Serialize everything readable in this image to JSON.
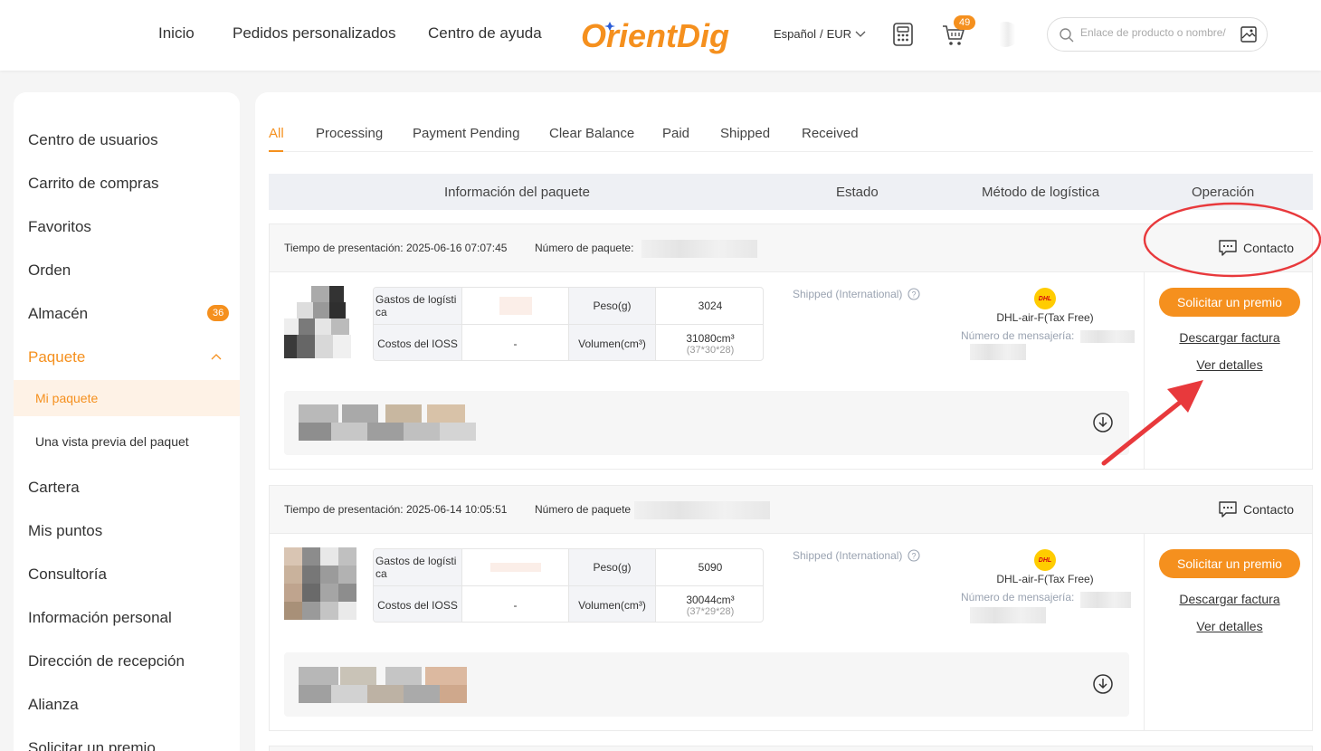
{
  "header": {
    "nav": [
      "Inicio",
      "Pedidos personalizados",
      "Centro de ayuda"
    ],
    "logo_text": "OrientDig",
    "language": "Español",
    "currency": "EUR",
    "cart_count": "49",
    "search_placeholder": "Enlace de producto o nombre/",
    "icons": [
      "calculator-icon",
      "cart-icon",
      "image-search-icon",
      "search-icon",
      "chevron-down-icon"
    ],
    "accent_color": "#f5901e"
  },
  "sidebar": {
    "items": [
      {
        "label": "Centro de usuarios"
      },
      {
        "label": "Carrito de compras"
      },
      {
        "label": "Favoritos"
      },
      {
        "label": "Orden"
      },
      {
        "label": "Almacén",
        "badge": "36"
      },
      {
        "label": "Paquete",
        "expanded": true
      },
      {
        "label": "Mi paquete",
        "sub": true,
        "active": true
      },
      {
        "label": "Una vista previa del paquet",
        "sub": true
      },
      {
        "label": "Cartera"
      },
      {
        "label": "Mis puntos"
      },
      {
        "label": "Consultoría"
      },
      {
        "label": "Información personal"
      },
      {
        "label": "Dirección de recepción"
      },
      {
        "label": "Alianza"
      },
      {
        "label": "Solicitar un premio"
      }
    ]
  },
  "tabs": [
    "All",
    "Processing",
    "Payment Pending",
    "Clear Balance",
    "Paid",
    "Shipped",
    "Received"
  ],
  "active_tab": "All",
  "table_headers": [
    "Información del paquete",
    "Estado",
    "Método de logística",
    "Operación"
  ],
  "labels": {
    "submit_time": "Tiempo de presentación:",
    "package_number": "Número de paquete:",
    "package_number_alt": "Número de paquete",
    "contact": "Contacto",
    "shipping_cost": "Gastos de logísti ca",
    "ioss_cost": "Costos del IOSS",
    "weight": "Peso(g)",
    "volume": "Volumen(cm³)",
    "tracking": "Número de mensajería:",
    "request_reward": "Solicitar un premio",
    "download_invoice": "Descargar factura",
    "view_details": "Ver detalles",
    "dhl_logo": "DHL"
  },
  "packages": [
    {
      "time": "2025-06-16 07:07:45",
      "ioss": "-",
      "weight": "3024",
      "volume": "31080cm³",
      "dimensions": "(37*30*28)",
      "status": "Shipped (International)",
      "carrier": "DHL-air-F(Tax Free)"
    },
    {
      "time": "2025-06-14 10:05:51",
      "ioss": "-",
      "weight": "5090",
      "volume": "30044cm³",
      "dimensions": "(37*29*28)",
      "status": "Shipped (International)",
      "carrier": "DHL-air-F(Tax Free)"
    }
  ],
  "annotation_color": "#e8393c"
}
